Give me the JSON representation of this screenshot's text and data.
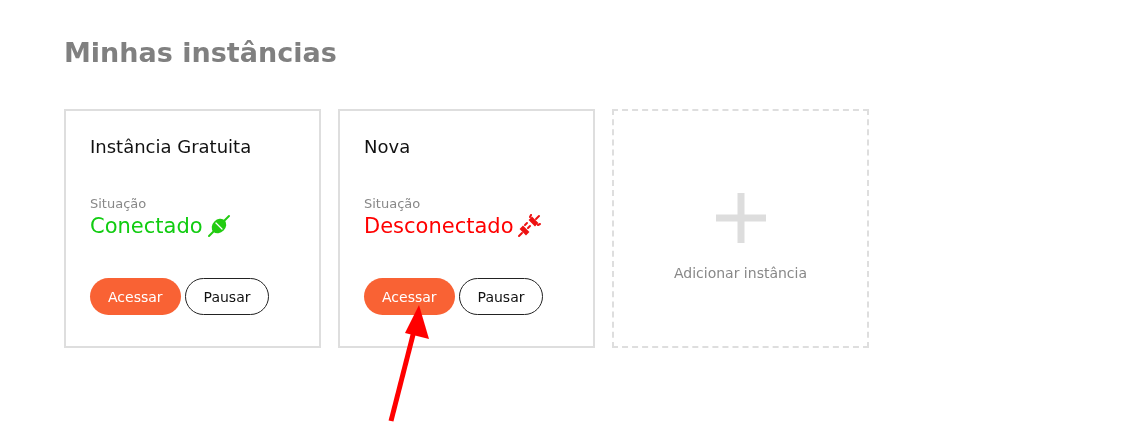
{
  "title": "Minhas instâncias",
  "instances": [
    {
      "name": "Instância Gratuita",
      "status_label": "Situação",
      "status": "Conectado",
      "connected": true,
      "buttons": [
        "Acessar",
        "Pausar"
      ]
    },
    {
      "name": "Nova",
      "status_label": "Situação",
      "status": "Desconectado",
      "connected": false,
      "buttons": [
        "Acessar",
        "Pausar"
      ]
    }
  ],
  "add_card": {
    "label": "Adicionar instância"
  }
}
